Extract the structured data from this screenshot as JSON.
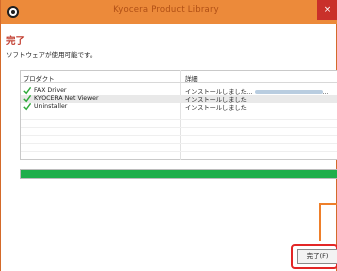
{
  "window": {
    "title": "Kyocera Product Library",
    "close_glyph": "×",
    "icon": "app-disc-icon"
  },
  "content": {
    "heading": "完了",
    "subheading": "ソフトウェアが使用可能です。"
  },
  "table": {
    "headers": {
      "name": "プロダクト",
      "detail": "詳細"
    },
    "rows": [
      {
        "name": "FAX Driver",
        "detail": "インストールしました...",
        "status_icon": "green-checkmark-icon",
        "selected": false
      },
      {
        "name": "KYOCERA Net Viewer",
        "detail": "インストールしました",
        "status_icon": "green-checkmark-icon",
        "selected": true
      },
      {
        "name": "Uninstaller",
        "detail": "インストールしました",
        "status_icon": "green-checkmark-icon",
        "selected": false
      }
    ],
    "first_row_trailing": "..."
  },
  "progress": {
    "percent": 100,
    "color": "#1fae4b"
  },
  "buttons": {
    "finish_label": "完了(F)"
  },
  "colors": {
    "titlebar": "#ec8a3a",
    "heading": "#c0392b",
    "highlight": "#e32626",
    "callout": "#ee7f2a"
  }
}
